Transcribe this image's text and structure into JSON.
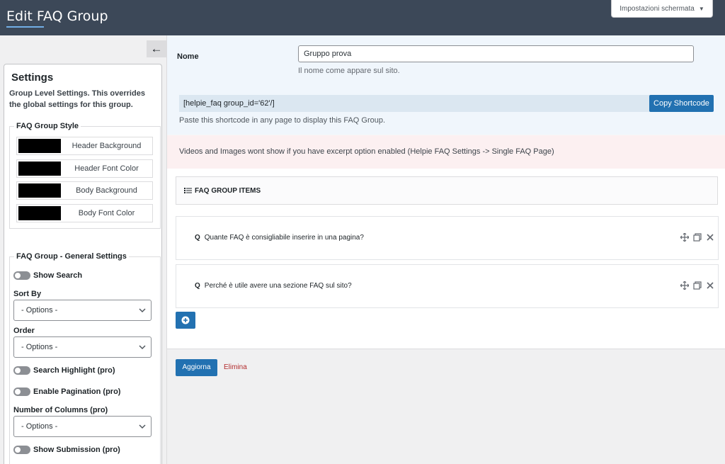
{
  "header": {
    "title": "Edit FAQ Group",
    "screen_options": "Impostazioni schermata"
  },
  "sidebar": {
    "settings_title": "Settings",
    "settings_desc": "Group Level Settings. This overrides the global settings for this group.",
    "style_legend": "FAQ Group Style",
    "colors": [
      {
        "label": "Header Background",
        "value": "#000000"
      },
      {
        "label": "Header Font Color",
        "value": "#000000"
      },
      {
        "label": "Body Background",
        "value": "#000000"
      },
      {
        "label": "Body Font Color",
        "value": "#000000"
      }
    ],
    "general_legend": "FAQ Group - General Settings",
    "show_search": "Show Search",
    "sort_by_label": "Sort By",
    "sort_by_value": "- Options -",
    "order_label": "Order",
    "order_value": "- Options -",
    "search_highlight": "Search Highlight (pro)",
    "enable_pagination": "Enable Pagination (pro)",
    "columns_label": "Number of Columns (pro)",
    "columns_value": "- Options -",
    "show_submission": "Show Submission (pro)"
  },
  "form": {
    "nome_label": "Nome",
    "nome_value": "Gruppo prova",
    "nome_help": "Il nome come appare sul sito.",
    "shortcode": "[helpie_faq group_id='62'/]",
    "copy_label": "Copy Shortcode",
    "shortcode_help": "Paste this shortcode in any page to display this FAQ Group."
  },
  "notice": "Videos and Images wont show if you have excerpt option enabled (Helpie FAQ Settings -> Single FAQ Page)",
  "items": {
    "header": "FAQ GROUP ITEMS",
    "list": [
      {
        "question": "Quante FAQ è consigliabile inserire in una pagina?"
      },
      {
        "question": "Perché è utile avere una sezione FAQ sul sito?"
      }
    ]
  },
  "footer": {
    "update_label": "Aggiorna",
    "delete_label": "Elimina"
  },
  "colors": {
    "primary": "#2271b1",
    "header_bg": "#3c4858",
    "notice_bg": "#fcf0f1",
    "danger": "#b32d2e"
  }
}
